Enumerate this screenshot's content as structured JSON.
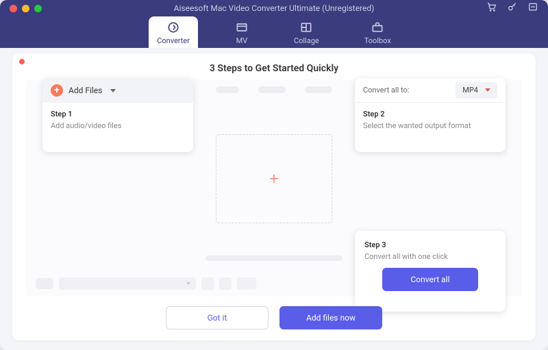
{
  "window": {
    "title": "Aiseesoft Mac Video Converter Ultimate (Unregistered)"
  },
  "tabs": {
    "converter": "Converter",
    "mv": "MV",
    "collage": "Collage",
    "toolbox": "Toolbox"
  },
  "onboarding": {
    "heading": "3 Steps to Get Started Quickly",
    "step1": {
      "add_files_label": "Add Files",
      "step_label": "Step 1",
      "description": "Add audio/video files"
    },
    "step2": {
      "convert_all_to_label": "Convert all to:",
      "selected_format": "MP4",
      "step_label": "Step 2",
      "description": "Select the wanted output format"
    },
    "step3": {
      "step_label": "Step 3",
      "description": "Convert all with one click",
      "convert_button": "Convert all"
    },
    "buttons": {
      "got_it": "Got it",
      "add_files_now": "Add files now"
    }
  }
}
